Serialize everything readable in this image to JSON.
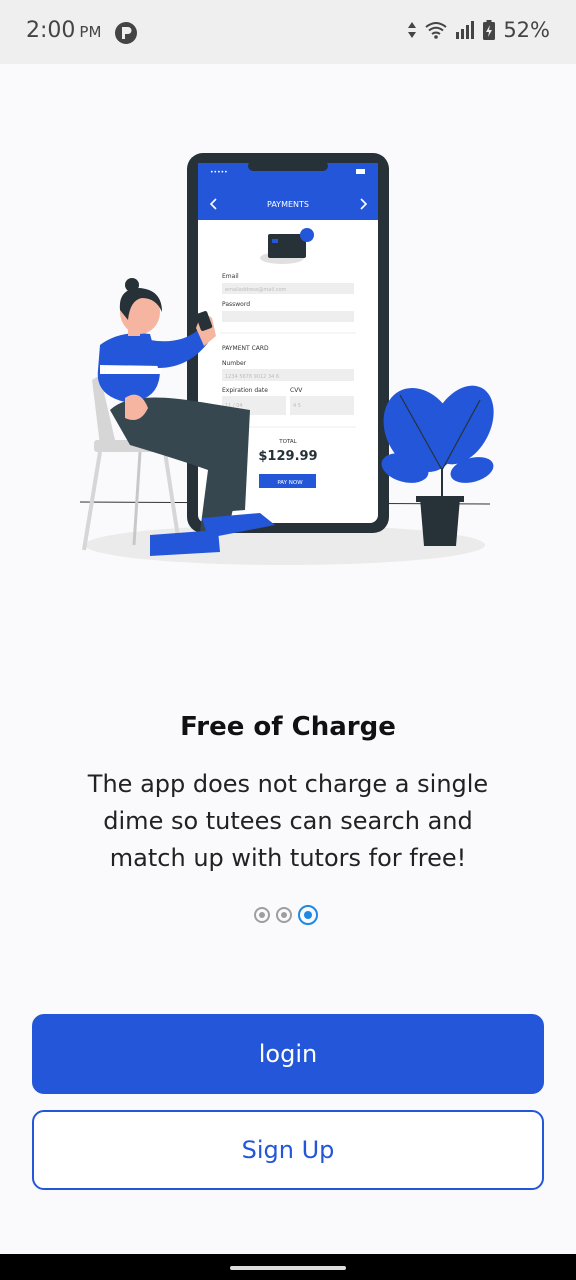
{
  "status_bar": {
    "time": "2:00",
    "ampm": "PM",
    "battery": "52%"
  },
  "illustration": {
    "screen_title": "PAYMENTS",
    "email_label": "Email",
    "email_placeholder": "emailaddress@mail.com",
    "password_label": "Password",
    "section_title": "PAYMENT CARD",
    "number_label": "Number",
    "number_value": "1234 5678 9012 34 6",
    "expiration_label": "Expiration date",
    "expiration_value": "11 / 04",
    "cvv_label": "CVV",
    "cvv_value": "4 5",
    "total_label": "TOTAL",
    "total_value": "$129.99",
    "pay_label": "PAY NOW"
  },
  "onboarding": {
    "title": "Free of Charge",
    "description": "The app does not charge a single dime so tutees can search and match up with tutors for free!",
    "current_page": 3,
    "page_count": 3
  },
  "buttons": {
    "login": "login",
    "signup": "Sign Up"
  },
  "colors": {
    "primary": "#2356D8",
    "indicator_active": "#1E88E5",
    "background": "#FAFAFC"
  }
}
